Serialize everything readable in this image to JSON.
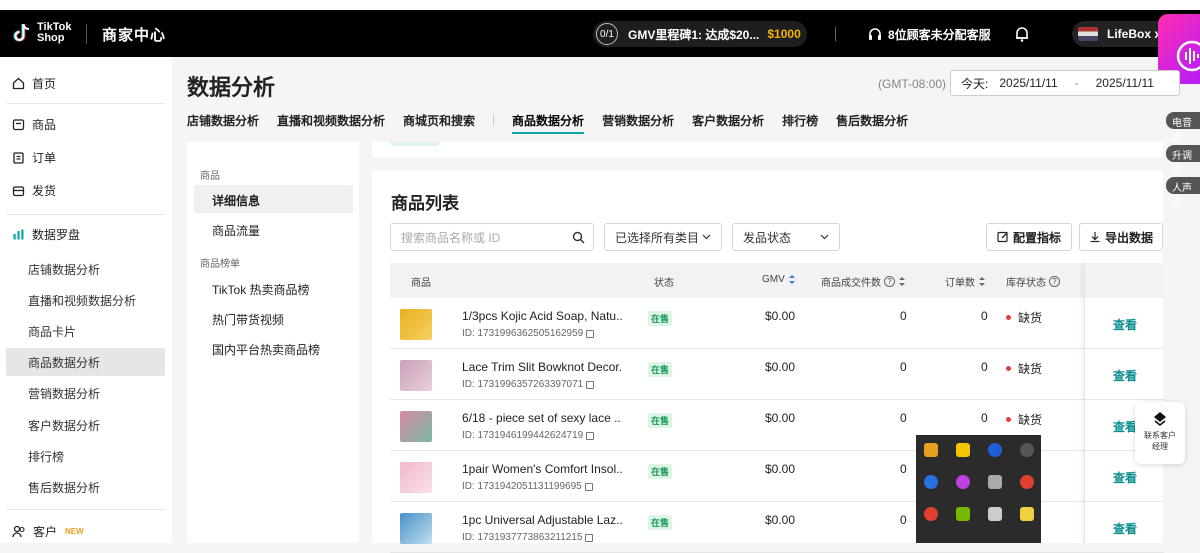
{
  "header": {
    "logo_line1": "TikTok",
    "logo_line2": "Shop",
    "center_title": "商家中心",
    "gmv_badge": "0/1",
    "gmv_text": "GMV里程碑1: 达成$20...",
    "gmv_amount": "$1000",
    "customer_service": "8位顾客未分配客服",
    "user_name": "LifeBox xu"
  },
  "sidebar": {
    "home": "首页",
    "products": "商品",
    "orders": "订单",
    "shipping": "发货",
    "compass": "数据罗盘",
    "sub_items": [
      "店铺数据分析",
      "直播和视频数据分析",
      "商品卡片",
      "商品数据分析",
      "营销数据分析",
      "客户数据分析",
      "排行榜",
      "售后数据分析"
    ],
    "customers": "客户",
    "new_badge": "NEW"
  },
  "page": {
    "title": "数据分析",
    "timezone": "(GMT-08:00)",
    "date_label": "今天:",
    "date_start": "2025/11/11",
    "date_sep": "-",
    "date_end": "2025/11/11"
  },
  "tabs": [
    "店铺数据分析",
    "直播和视频数据分析",
    "商城页和搜索",
    "商品数据分析",
    "营销数据分析",
    "客户数据分析",
    "排行榜",
    "售后数据分析"
  ],
  "side_pills": [
    "电音大",
    "升调降",
    "人声消"
  ],
  "subnav": {
    "group1": "商品",
    "items1": [
      "详细信息",
      "商品流量"
    ],
    "group2": "商品榜单",
    "items2": [
      "TikTok 热卖商品榜",
      "热门带货视频",
      "国内平台热卖商品榜"
    ]
  },
  "list": {
    "title": "商品列表",
    "search_placeholder": "搜索商品名称或 ID",
    "category_select": "已选择所有类目",
    "status_select": "发品状态",
    "config_button": "配置指标",
    "export_button": "导出数据",
    "columns": [
      "商品",
      "状态",
      "GMV",
      "商品成交件数",
      "订单数",
      "库存状态"
    ],
    "rows": [
      {
        "name": "1/3pcs Kojic Acid Soap, Natu...",
        "id": "ID: 1731996362505162959",
        "status": "在售",
        "gmv": "$0.00",
        "units": "0",
        "orders": "0",
        "stock": "缺货",
        "action": "查看"
      },
      {
        "name": "Lace Trim Slit Bowknot Decor...",
        "id": "ID: 1731996357263397071",
        "status": "在售",
        "gmv": "$0.00",
        "units": "0",
        "orders": "0",
        "stock": "缺货",
        "action": "查看"
      },
      {
        "name": "6/18 - piece set of sexy lace ...",
        "id": "ID: 1731946199442624719",
        "status": "在售",
        "gmv": "$0.00",
        "units": "0",
        "orders": "0",
        "stock": "缺货",
        "action": "查看"
      },
      {
        "name": "1pair Women's Comfort Insol...",
        "id": "ID: 1731942051131199695",
        "status": "在售",
        "gmv": "$0.00",
        "units": "0",
        "orders": "",
        "stock": "",
        "action": "查看"
      },
      {
        "name": "1pc Universal Adjustable Laz...",
        "id": "ID: 1731937773863211215",
        "status": "在售",
        "gmv": "$0.00",
        "units": "0",
        "orders": "",
        "stock": "",
        "action": "查看"
      }
    ]
  },
  "contact": {
    "line1": "联系客户",
    "line2": "经理"
  },
  "colors": {
    "accent": "#0aa5a5",
    "status_green": "#169a5a",
    "stock_red": "#e0403a",
    "gmv_gold": "#f4b400"
  }
}
